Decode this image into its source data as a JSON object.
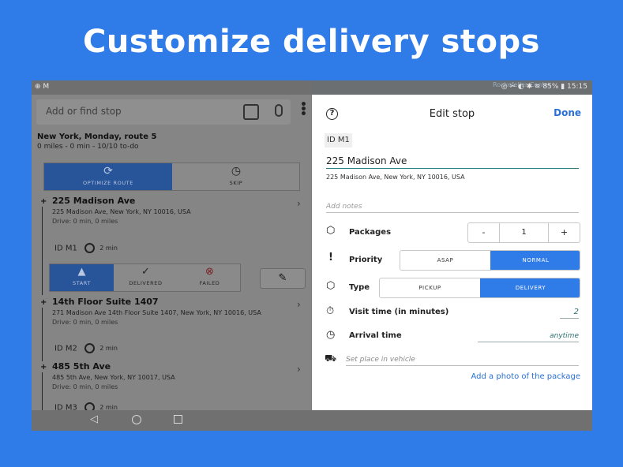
{
  "headline": "Customize delivery stops",
  "status": {
    "left_icons": "⊕ M",
    "map_label": "Rockefeller Center",
    "right": "◎ ✂ ◐ ✱ ≋ 85% ▮ 15:15"
  },
  "search": {
    "placeholder": "Add or find stop"
  },
  "route": {
    "title": "New York, Monday, route 5",
    "summary": "0 miles - 0 min - 10/10 to-do",
    "optimize_label": "OPTIMIZE ROUTE",
    "skip_label": "SKIP"
  },
  "stops": [
    {
      "name": "225 Madison Ave",
      "address": "225 Madison Ave, New York, NY 10016, USA",
      "drive": "Drive: 0 min, 0 miles",
      "id": "ID M1",
      "time": "2 min"
    },
    {
      "name": "14th Floor Suite 1407",
      "address": "271 Madison Ave 14th Floor Suite 1407, New York, NY 10016, USA",
      "drive": "Drive: 0 min, 0 miles",
      "id": "ID M2",
      "time": "2 min"
    },
    {
      "name": "485 5th Ave",
      "address": "485 5th Ave, New York, NY 10017, USA",
      "drive": "Drive: 0 min, 0 miles",
      "id": "ID M3",
      "time": "2 min"
    }
  ],
  "stop_actions": {
    "start": "START",
    "delivered": "DELIVERED",
    "failed": "FAILED"
  },
  "edit": {
    "title": "Edit stop",
    "done": "Done",
    "id_chip": "ID M1",
    "address_value": "225 Madison Ave",
    "address_full": "225 Madison Ave, New York, NY 10016, USA",
    "notes_placeholder": "Add notes",
    "packages_label": "Packages",
    "packages_minus": "-",
    "packages_value": "1",
    "packages_plus": "+",
    "priority_label": "Priority",
    "priority_options": [
      "ASAP",
      "NORMAL"
    ],
    "priority_selected": "NORMAL",
    "type_label": "Type",
    "type_options": [
      "PICKUP",
      "DELIVERY"
    ],
    "type_selected": "DELIVERY",
    "visit_label": "Visit time (in minutes)",
    "visit_value": "2",
    "arrival_label": "Arrival time",
    "arrival_value": "anytime",
    "vehicle_placeholder": "Set place in vehicle",
    "photo_link": "Add a photo of the package"
  },
  "colors": {
    "background": "#2f7be8",
    "accent": "#2f7be8",
    "link": "#2a6fd6"
  }
}
